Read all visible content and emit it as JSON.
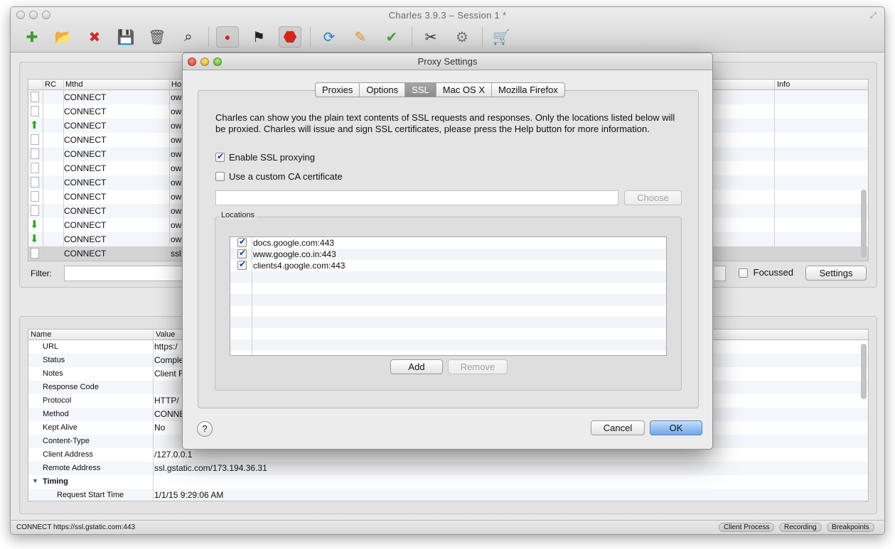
{
  "window": {
    "title": "Charles 3.9.3 – Session 1 *"
  },
  "toolbar": {
    "icons": [
      "new-session-icon",
      "open-icon",
      "close-session-icon",
      "save-icon",
      "trash-icon",
      "find-binoculars-icon",
      "record-icon",
      "throttle-flag-icon",
      "breakpoints-stop-icon",
      "repeat-icon",
      "edit-pencil-icon",
      "validate-check-icon",
      "tools-icon",
      "settings-gear-icon",
      "shopping-basket-icon"
    ]
  },
  "sessions": {
    "headers": {
      "rc": "RC",
      "method": "Mthd",
      "host": "Ho",
      "info": "Info"
    },
    "rows": [
      {
        "icon": "doc",
        "method": "CONNECT",
        "host": "ow"
      },
      {
        "icon": "doc",
        "method": "CONNECT",
        "host": "ow"
      },
      {
        "icon": "up",
        "method": "CONNECT",
        "host": "ow"
      },
      {
        "icon": "doc",
        "method": "CONNECT",
        "host": "ow"
      },
      {
        "icon": "doc",
        "method": "CONNECT",
        "host": "ow"
      },
      {
        "icon": "doc",
        "method": "CONNECT",
        "host": "ow"
      },
      {
        "icon": "doc",
        "method": "CONNECT",
        "host": "ow"
      },
      {
        "icon": "doc",
        "method": "CONNECT",
        "host": "ow"
      },
      {
        "icon": "doc",
        "method": "CONNECT",
        "host": "ow"
      },
      {
        "icon": "down",
        "method": "CONNECT",
        "host": "ow"
      },
      {
        "icon": "down",
        "method": "CONNECT",
        "host": "ow"
      },
      {
        "icon": "doc",
        "method": "CONNECT",
        "host": "ssl."
      }
    ],
    "filter_label": "Filter:",
    "focussed_label": "Focussed",
    "settings_label": "Settings"
  },
  "details": {
    "headers": {
      "name": "Name",
      "value": "Value"
    },
    "rows": [
      {
        "name": "URL",
        "value": "https:/"
      },
      {
        "name": "Status",
        "value": "Comple"
      },
      {
        "name": "Notes",
        "value": "Client F"
      },
      {
        "name": "Response Code",
        "value": ""
      },
      {
        "name": "Protocol",
        "value": "HTTP/"
      },
      {
        "name": "Method",
        "value": "CONNE"
      },
      {
        "name": "Kept Alive",
        "value": "No"
      },
      {
        "name": "Content-Type",
        "value": ""
      },
      {
        "name": "Client Address",
        "value": "/127.0.0.1"
      },
      {
        "name": "Remote Address",
        "value": "ssl.gstatic.com/173.194.36.31"
      }
    ],
    "timing_label": "Timing",
    "timing_rows": [
      {
        "name": "Request Start Time",
        "value": "1/1/15 9:29:06 AM"
      }
    ]
  },
  "statusbar": {
    "text": "CONNECT https://ssl.gstatic.com:443",
    "client_process": "Client Process",
    "recording": "Recording",
    "breakpoints": "Breakpoints"
  },
  "dialog": {
    "title": "Proxy Settings",
    "tabs": [
      "Proxies",
      "Options",
      "SSL",
      "Mac OS X",
      "Mozilla Firefox"
    ],
    "active_tab": "SSL",
    "description": "Charles can show you the plain text contents of SSL requests and responses. Only the locations listed below will be proxied. Charles will issue and sign SSL certificates, please press the Help button for more information.",
    "enable_ssl_label": "Enable SSL proxying",
    "enable_ssl_checked": true,
    "custom_ca_label": "Use a custom CA certificate",
    "custom_ca_checked": false,
    "ca_path_value": "",
    "choose_label": "Choose",
    "locations_legend": "Locations",
    "locations": [
      {
        "checked": true,
        "host": "docs.google.com:443"
      },
      {
        "checked": true,
        "host": "www.google.co.in:443"
      },
      {
        "checked": true,
        "host": "clients4.google.com:443"
      }
    ],
    "add_label": "Add",
    "remove_label": "Remove",
    "help_label": "?",
    "cancel_label": "Cancel",
    "ok_label": "OK"
  }
}
